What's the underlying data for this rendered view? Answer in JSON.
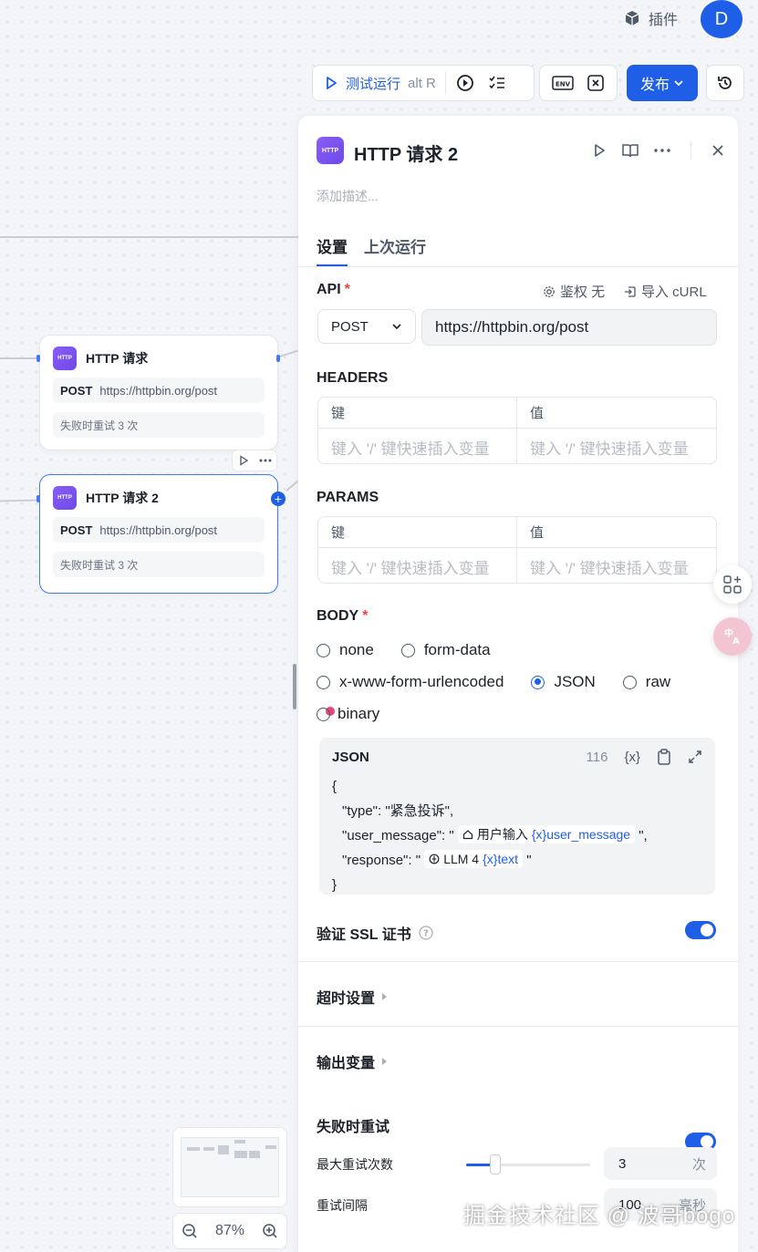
{
  "topbar": {
    "plugin_label": "插件",
    "avatar_initial": "D"
  },
  "toolbar": {
    "run_label": "测试运行",
    "run_shortcut": "alt  R",
    "env_label": "ENV",
    "publish_label": "发布"
  },
  "canvas": {
    "node1": {
      "title": "HTTP 请求",
      "method": "POST",
      "url": "https://httpbin.org/post",
      "retry": "失败时重试 3 次"
    },
    "node2": {
      "title": "HTTP 请求 2",
      "method": "POST",
      "url": "https://httpbin.org/post",
      "retry": "失败时重试 3 次"
    },
    "logo_text": "HTTP",
    "zoom": "87%"
  },
  "panel": {
    "logo_text": "HTTP",
    "title": "HTTP 请求 2",
    "description_placeholder": "添加描述...",
    "tabs": [
      {
        "label": "设置"
      },
      {
        "label": "上次运行"
      }
    ],
    "api": {
      "label": "API",
      "required_mark": "*",
      "auth_label": "鉴权 无",
      "import_label": "导入 cURL",
      "method": "POST",
      "url": "https://httpbin.org/post"
    },
    "headers": {
      "label": "HEADERS",
      "key_header": "键",
      "value_header": "值",
      "key_placeholder": "键入 '/' 键快速插入变量",
      "value_placeholder": "键入 '/' 键快速插入变量"
    },
    "params": {
      "label": "PARAMS",
      "key_header": "键",
      "value_header": "值",
      "key_placeholder": "键入 '/' 键快速插入变量",
      "value_placeholder": "键入 '/' 键快速插入变量"
    },
    "body": {
      "label": "BODY",
      "required_mark": "*",
      "options": [
        "none",
        "form-data",
        "x-www-form-urlencoded",
        "JSON",
        "raw",
        "binary"
      ],
      "selected": "JSON"
    },
    "json_editor": {
      "label": "JSON",
      "char_count": "116",
      "var_icon": "{x}",
      "open_brace": "{",
      "close_brace": "}",
      "line1_key": "\"type\": \"紧急投诉\",",
      "line2_key": "\"user_message\": \"",
      "line2_node": "用户输入",
      "line2_var": "user_message",
      "line2_tail": "\",",
      "line3_key": "\"response\": \"",
      "line3_node": "LLM 4",
      "line3_var": "text",
      "line3_tail": "\""
    },
    "ssl": {
      "label": "验证 SSL 证书",
      "enabled": true
    },
    "timeout": {
      "label": "超时设置"
    },
    "output": {
      "label": "输出变量"
    },
    "retry": {
      "label": "失败时重试",
      "enabled": true,
      "max_label": "最大重试次数",
      "max_value": "3",
      "max_unit": "次",
      "max_fraction": 0.2,
      "interval_label": "重试间隔",
      "interval_value": "100",
      "interval_unit": "毫秒"
    }
  },
  "watermark": "掘金技术社区 @ 波哥bogo",
  "colors": {
    "accent": "#1f5ee6",
    "http_logo": "#7c52f0",
    "required": "#f53f3f"
  }
}
